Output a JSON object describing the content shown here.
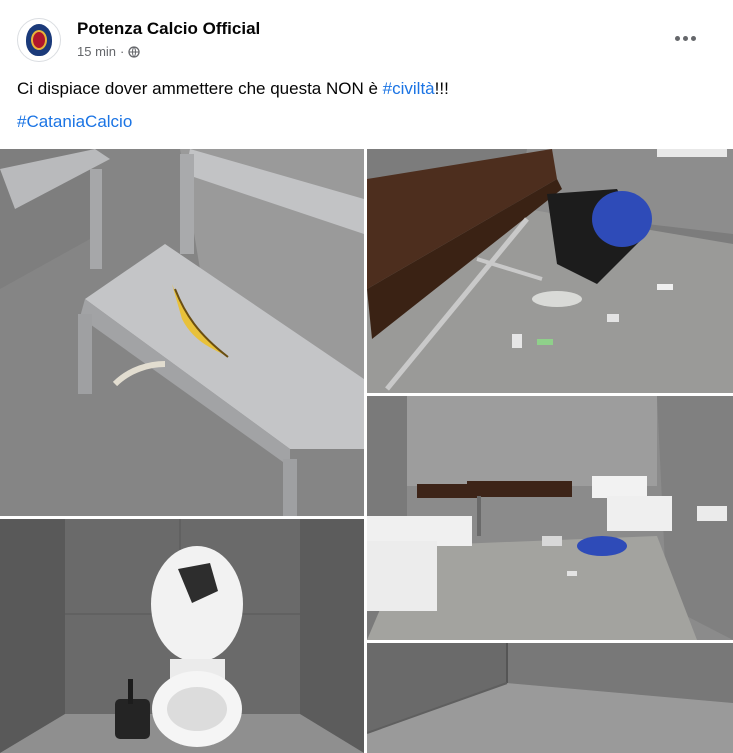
{
  "post": {
    "page_name": "Potenza Calcio Official",
    "time": "15 min",
    "separator": "·",
    "privacy_icon": "globe-icon",
    "more_icon": "more-options-icon",
    "text_before": "Ci dispiace dover ammettere che questa NON è ",
    "hashtag_1": "#civiltà",
    "text_after": "!!!",
    "hashtag_2": "#CataniaCalcio"
  },
  "colors": {
    "link": "#1b74e4",
    "secondary_text": "#65676b",
    "primary_text": "#050505"
  }
}
